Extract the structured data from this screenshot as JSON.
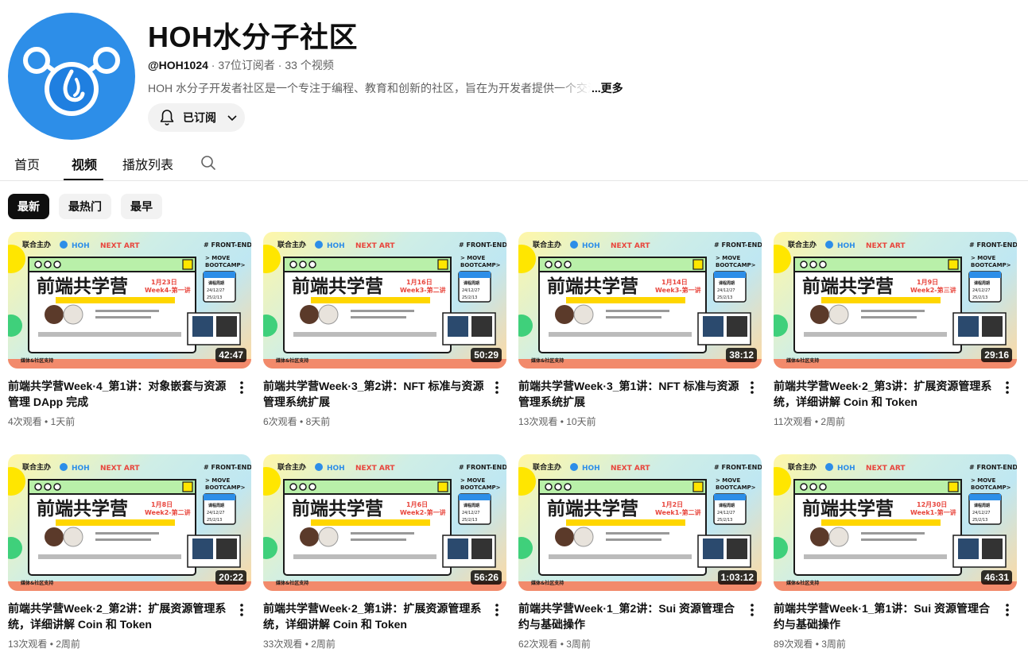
{
  "channel": {
    "title": "HOH水分子社区",
    "handle": "@HOH1024",
    "stats": " · 37位订阅者 · 33 个视频",
    "description": "HOH 水分子开发者社区是一个专注于编程、教育和创新的社区，旨在为开发者提供一个交流",
    "more_label": "...更多",
    "subscribe_label": "已订阅",
    "avatar_icon": "water-molecule-logo-icon",
    "avatar_color": "#2d8ee8"
  },
  "tabs": [
    {
      "label": "首页"
    },
    {
      "label": "视频"
    },
    {
      "label": "播放列表"
    }
  ],
  "active_tab": "视频",
  "chips": [
    {
      "label": "最新"
    },
    {
      "label": "最热门"
    },
    {
      "label": "最早"
    }
  ],
  "thumbnail": {
    "header_left": "联合主办",
    "brand_hoh": "HOH",
    "brand_art": "NEXT ART",
    "tag_frontend": "# FRONT-END",
    "tag_move": "> MOVE",
    "tag_bootcamp": "BOOTCAMP>",
    "main_title": "前端共学营",
    "schedule_label": "课程周期",
    "schedule_start": "24/12/27",
    "schedule_end": "25/2/13",
    "footer": "媒体&社区支持"
  },
  "videos": [
    {
      "title": "前端共学营Week·4_第1讲：对象嵌套与资源管理 DApp 完成",
      "duration": "42:47",
      "views": "4次观看",
      "age": "1天前",
      "date_label": "1月23日",
      "week_label": "Week4-第一讲"
    },
    {
      "title": "前端共学营Week·3_第2讲：NFT 标准与资源管理系统扩展",
      "duration": "50:29",
      "views": "6次观看",
      "age": "8天前",
      "date_label": "1月16日",
      "week_label": "Week3-第二讲"
    },
    {
      "title": "前端共学营Week·3_第1讲：NFT 标准与资源管理系统扩展",
      "duration": "38:12",
      "views": "13次观看",
      "age": "10天前",
      "date_label": "1月14日",
      "week_label": "Week3-第一讲"
    },
    {
      "title": "前端共学营Week·2_第3讲：扩展资源管理系统，详细讲解 Coin 和 Token",
      "duration": "29:16",
      "views": "11次观看",
      "age": "2周前",
      "date_label": "1月9日",
      "week_label": "Week2-第三讲"
    },
    {
      "title": "前端共学营Week·2_第2讲：扩展资源管理系统，详细讲解 Coin 和 Token",
      "duration": "20:22",
      "views": "13次观看",
      "age": "2周前",
      "date_label": "1月8日",
      "week_label": "Week2-第二讲"
    },
    {
      "title": "前端共学营Week·2_第1讲：扩展资源管理系统，详细讲解 Coin 和 Token",
      "duration": "56:26",
      "views": "33次观看",
      "age": "2周前",
      "date_label": "1月6日",
      "week_label": "Week2-第一讲"
    },
    {
      "title": "前端共学营Week·1_第2讲：Sui 资源管理合约与基础操作",
      "duration": "1:03:12",
      "views": "62次观看",
      "age": "3周前",
      "date_label": "1月2日",
      "week_label": "Week1-第二讲"
    },
    {
      "title": "前端共学营Week·1_第1讲：Sui 资源管理合约与基础操作",
      "duration": "46:31",
      "views": "89次观看",
      "age": "3周前",
      "date_label": "12月30日",
      "week_label": "Week1-第一讲"
    }
  ],
  "colors": {
    "accent_dark": "#0f0f0f",
    "muted_text": "#606060",
    "chip_bg": "#f2f2f2",
    "thumb_red": "#e8453c",
    "thumb_yellow": "#ffd600",
    "thumb_green": "#2ecc71"
  }
}
